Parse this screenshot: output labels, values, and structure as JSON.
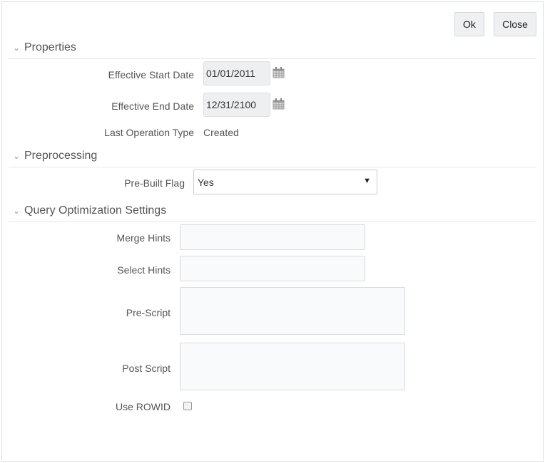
{
  "buttons": {
    "ok": "Ok",
    "close": "Close"
  },
  "sections": {
    "properties": {
      "title": "Properties",
      "effective_start_date_label": "Effective Start Date",
      "effective_start_date": "01/01/2011",
      "effective_end_date_label": "Effective End Date",
      "effective_end_date": "12/31/2100",
      "last_operation_type_label": "Last Operation Type",
      "last_operation_type": "Created"
    },
    "preprocessing": {
      "title": "Preprocessing",
      "pre_built_flag_label": "Pre-Built Flag",
      "pre_built_flag": "Yes"
    },
    "query": {
      "title": "Query Optimization Settings",
      "merge_hints_label": "Merge Hints",
      "merge_hints": "",
      "select_hints_label": "Select Hints",
      "select_hints": "",
      "pre_script_label": "Pre-Script",
      "pre_script": "",
      "post_script_label": "Post Script",
      "post_script": "",
      "use_rowid_label": "Use ROWID",
      "use_rowid": false
    }
  },
  "icons": {
    "section": "chevron-down-icon",
    "date": "calendar-icon",
    "select": "dropdown-arrow-icon"
  }
}
